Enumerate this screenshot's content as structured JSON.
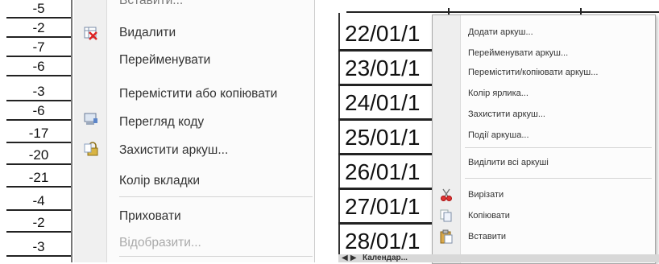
{
  "left_numbers": [
    "-5",
    "-2",
    "-7",
    "-6",
    "-3",
    "-6",
    "-17",
    "-20",
    "-21",
    "-4",
    "-2",
    "-3"
  ],
  "left_menu": {
    "top_item_partial": "Вставити...",
    "items": [
      {
        "label": "Видалити",
        "icon": "delete-sheet-icon"
      },
      {
        "label": "Перейменувати",
        "icon": ""
      },
      {
        "label": "Перемістити або копіювати",
        "icon": ""
      },
      {
        "label": "Перегляд коду",
        "icon": "view-code-icon"
      },
      {
        "label": "Захистити аркуш...",
        "icon": "protect-sheet-icon"
      },
      {
        "label": "Колір вкладки",
        "icon": ""
      },
      {
        "label": "Приховати",
        "icon": ""
      },
      {
        "label": "Відобразити...",
        "icon": "",
        "disabled": true
      }
    ]
  },
  "dates": [
    "22/01/1",
    "23/01/1",
    "24/01/1",
    "25/01/1",
    "26/01/1",
    "27/01/1",
    "28/01/1"
  ],
  "right_menu": {
    "items": [
      {
        "label": "Додати аркуш..."
      },
      {
        "label": "Перейменувати аркуш..."
      },
      {
        "label": "Перемістити/копіювати аркуш..."
      },
      {
        "label": "Колір ярлика..."
      },
      {
        "label": "Захистити аркуш..."
      },
      {
        "label": "Події аркуша..."
      },
      {
        "label": "Виділити всі аркуші"
      },
      {
        "label": "Вирізати",
        "icon": "cut-icon"
      },
      {
        "label": "Копіювати",
        "icon": "copy-icon"
      },
      {
        "label": "Вставити",
        "icon": "paste-icon"
      }
    ]
  },
  "tabbar": {
    "nav": "◀ ▶",
    "label": "Календар..."
  },
  "colors": {
    "menu_bg": "#fbfbfb",
    "icon_bar": "#f0f0f0",
    "grid_line": "#222222"
  }
}
